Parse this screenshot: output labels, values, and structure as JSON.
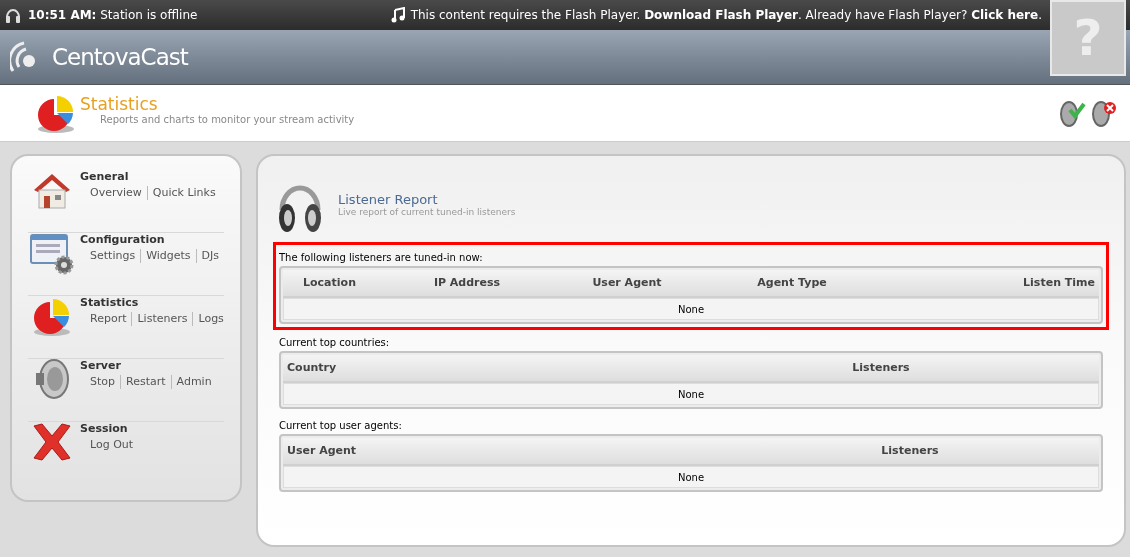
{
  "top_bar": {
    "status": "**10:51 AM:** Station is offline",
    "flash_notice": "This content requires the Flash Player. **Download Flash Player**. Already have Flash Player? **Click here**."
  },
  "flash_placeholder": {
    "glyph": "?"
  },
  "logo": {
    "text": "CentovaCast"
  },
  "page_header": {
    "title": "Statistics",
    "subtitle": "Reports and charts to monitor your stream activity"
  },
  "sidebar": {
    "items": [
      {
        "kind": "house",
        "title": "General",
        "links": [
          "Overview",
          "Quick Links"
        ]
      },
      {
        "kind": "config",
        "title": "Configuration",
        "links": [
          "Settings",
          "Widgets",
          "DJs"
        ]
      },
      {
        "kind": "chart",
        "title": "Statistics",
        "links": [
          "Report",
          "Listeners",
          "Logs"
        ]
      },
      {
        "kind": "speaker",
        "title": "Server",
        "links": [
          "Stop",
          "Restart",
          "Admin"
        ]
      },
      {
        "kind": "cross",
        "title": "Session",
        "links": [
          "Log Out"
        ]
      }
    ]
  },
  "report": {
    "title": "Listener Report",
    "subtitle": "Live report of current tuned-in listeners",
    "sections": [
      {
        "caption": "The following listeners are tuned-in now:",
        "highlighted": true,
        "columns": [
          "Location",
          "IP Address",
          "User Agent",
          "Agent Type",
          "Listen Time"
        ],
        "empty_text": "None"
      },
      {
        "caption": "Current top countries:",
        "highlighted": false,
        "columns": [
          "Country",
          "Listeners"
        ],
        "empty_text": "None"
      },
      {
        "caption": "Current top user agents:",
        "highlighted": false,
        "columns": [
          "User Agent",
          "Listeners"
        ],
        "empty_text": "None"
      }
    ]
  }
}
